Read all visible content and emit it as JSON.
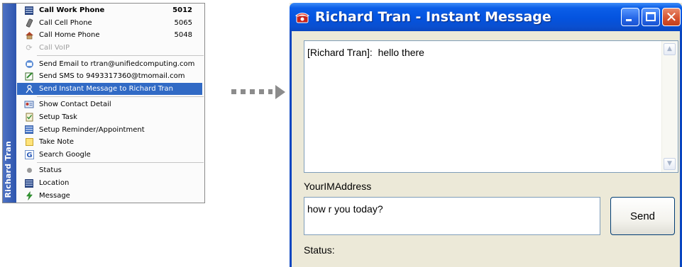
{
  "context_menu": {
    "contact_name": "Richard Tran",
    "groups": [
      [
        {
          "label": "Call Work Phone",
          "number": "5012",
          "bold": true,
          "icon": "phone-grid-icon"
        },
        {
          "label": "Call Cell Phone",
          "number": "5065",
          "icon": "cell-phone-icon"
        },
        {
          "label": "Call Home Phone",
          "number": "5048",
          "icon": "home-icon"
        },
        {
          "label": "Call VoIP",
          "disabled": true,
          "icon": "voip-icon"
        }
      ],
      [
        {
          "label": "Send Email to rtran@unifiedcomputing.com",
          "icon": "email-icon"
        },
        {
          "label": "Send SMS to 9493317360@tmomail.com",
          "icon": "sms-icon"
        },
        {
          "label": "Send Instant Message to Richard Tran",
          "selected": true,
          "icon": "instant-message-icon"
        }
      ],
      [
        {
          "label": "Show Contact Detail",
          "icon": "contact-card-icon"
        },
        {
          "label": "Setup Task",
          "icon": "task-icon"
        },
        {
          "label": "Setup Reminder/Appointment",
          "icon": "calendar-icon"
        },
        {
          "label": "Take Note",
          "icon": "note-icon"
        },
        {
          "label": "Search Google",
          "icon": "google-icon"
        }
      ],
      [
        {
          "label": "Status",
          "icon": "status-dot-icon"
        },
        {
          "label": "Location",
          "icon": "location-grid-icon"
        },
        {
          "label": "Message",
          "icon": "lightning-icon"
        }
      ]
    ]
  },
  "im_window": {
    "title": "Richard Tran - Instant Message",
    "history_text": "[Richard Tran]:  hello there",
    "address_label": "YourIMAddress",
    "compose_text": "how r you today?",
    "send_label": "Send",
    "status_label": "Status:"
  },
  "colors": {
    "titlebar": "#0453df",
    "selection": "#316ac5",
    "menu_strip": "#2d55ae",
    "close_button": "#d5512d"
  }
}
